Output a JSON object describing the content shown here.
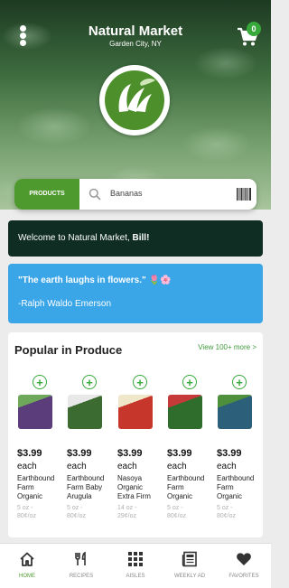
{
  "header": {
    "title": "Natural Market",
    "location": "Garden City, NY",
    "cart_count": "0"
  },
  "search": {
    "category_button": "PRODUCTS",
    "query": "Bananas"
  },
  "welcome": {
    "prefix": "Welcome to Natural Market, ",
    "name": "Bill!"
  },
  "quote": {
    "text": "\"The earth laughs in flowers.\" 🌷🌸",
    "author": "-Ralph Waldo Emerson"
  },
  "popular": {
    "title": "Popular in Produce",
    "view_more": "View 100+ more >",
    "products": [
      {
        "price": "$3.99",
        "unit": "each",
        "name": "Earthbound\nFarm\nOrganic\nSpring Mix",
        "size": "5 oz -\n80¢/oz",
        "image_colors": [
          "#5a3d7a",
          "#6fa85a"
        ]
      },
      {
        "price": "$3.99",
        "unit": "each",
        "name": "Earthbound\nFarm Baby\nArugula",
        "size": "5 oz -\n80¢/oz",
        "image_colors": [
          "#3c6b32",
          "#e8e8e8"
        ]
      },
      {
        "price": "$3.99",
        "unit": "each",
        "name": "Nasoya\nOrganic\nExtra Firm\nTofu",
        "size": "14 oz -\n29¢/oz",
        "image_colors": [
          "#c6362b",
          "#f0e6c9"
        ]
      },
      {
        "price": "$3.99",
        "unit": "each",
        "name": "Earthbound\nFarm\nOrganic\nBaby",
        "size": "5 oz -\n80¢/oz",
        "image_colors": [
          "#2f6d2c",
          "#c63a3a"
        ]
      },
      {
        "price": "$3.99",
        "unit": "each",
        "name": "Earthbound\nFarm\nOrganic\nBaby",
        "size": "5 oz -\n80¢/oz",
        "image_colors": [
          "#2c5f7a",
          "#4e8f3c"
        ]
      }
    ]
  },
  "nav": [
    {
      "label": "HOME",
      "icon": "home-icon",
      "active": true
    },
    {
      "label": "RECIPES",
      "icon": "utensils-icon",
      "active": false
    },
    {
      "label": "AISLES",
      "icon": "grid-icon",
      "active": false
    },
    {
      "label": "WEEKLY AD",
      "icon": "newspaper-icon",
      "active": false
    },
    {
      "label": "FAVORITES",
      "icon": "heart-icon",
      "active": false
    }
  ],
  "colors": {
    "accent": "#4f9a2f",
    "welcome_bg": "#0f2d22",
    "quote_bg": "#3aa5e7",
    "badge": "#36a93a"
  }
}
